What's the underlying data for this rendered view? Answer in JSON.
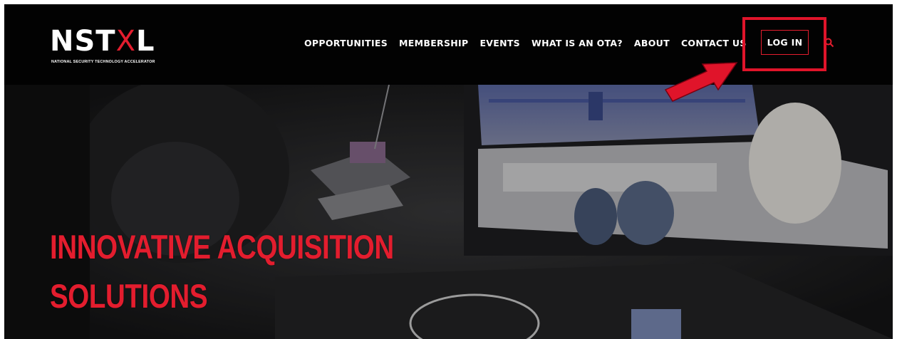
{
  "brand": {
    "logo_word_left": "NST",
    "logo_word_x": "X",
    "logo_word_right": "L",
    "logo_subtitle": "NATIONAL SECURITY TECHNOLOGY ACCELERATOR",
    "accent_color": "#e31d2e"
  },
  "nav": {
    "items": [
      {
        "label": "OPPORTUNITIES"
      },
      {
        "label": "MEMBERSHIP"
      },
      {
        "label": "EVENTS"
      },
      {
        "label": "WHAT IS AN OTA?"
      },
      {
        "label": "ABOUT"
      },
      {
        "label": "CONTACT US"
      }
    ],
    "login_label": "LOG IN",
    "search_icon": "search-icon"
  },
  "hero": {
    "heading_line1": "INNOVATIVE ACQUISITION",
    "heading_line2": "SOLUTIONS"
  }
}
